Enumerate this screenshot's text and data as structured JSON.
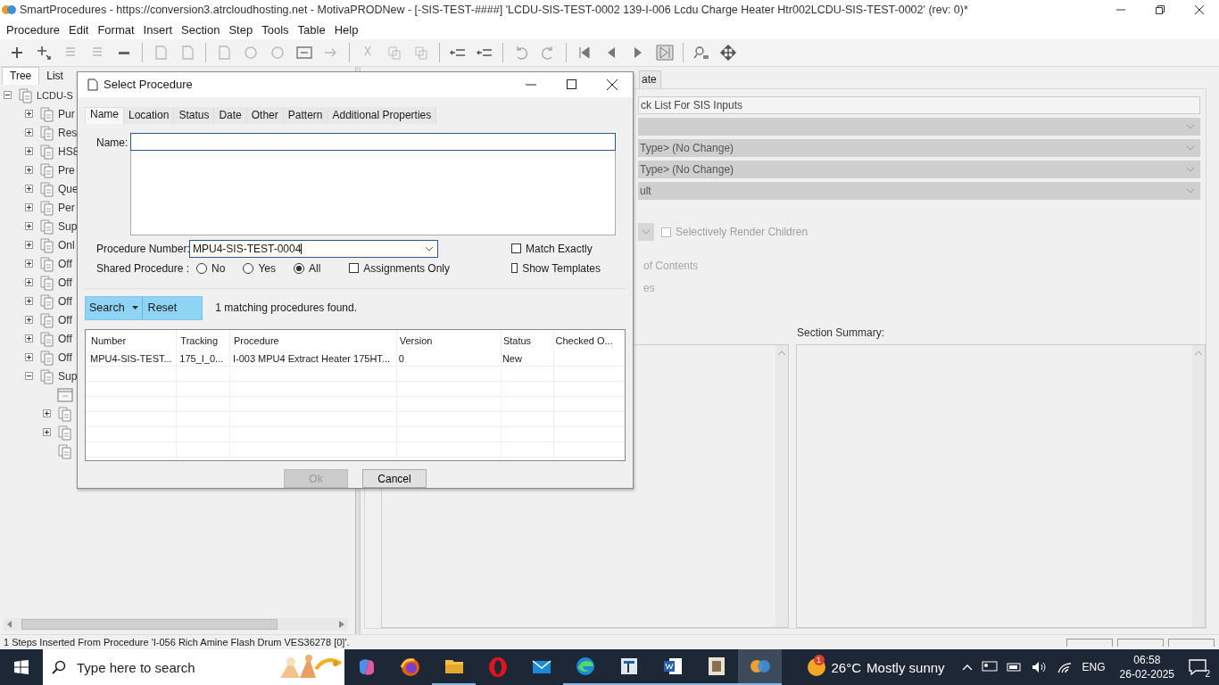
{
  "window": {
    "title": "SmartProcedures - https://conversion3.atrcloudhosting.net - MotivaPRODNew - [-SIS-TEST-####] 'LCDU-SIS-TEST-0002 139-I-006 Lcdu Charge Heater Htr002LCDU-SIS-TEST-0002' (rev: 0)*"
  },
  "menu": [
    "Procedure",
    "Edit",
    "Format",
    "Insert",
    "Section",
    "Step",
    "Tools",
    "Table",
    "Help"
  ],
  "left_panel": {
    "tabs": [
      {
        "label": "Tree",
        "selected": true
      },
      {
        "label": "List",
        "selected": false
      }
    ],
    "tree": {
      "label": "LCDU-S",
      "expanded": true,
      "children": [
        {
          "label": "Pur",
          "expanded": false
        },
        {
          "label": "Res",
          "expanded": false
        },
        {
          "label": "HS8",
          "expanded": false
        },
        {
          "label": "Pre",
          "expanded": false
        },
        {
          "label": "Que",
          "expanded": false
        },
        {
          "label": "Per",
          "expanded": false
        },
        {
          "label": "Sup",
          "expanded": false
        },
        {
          "label": "Onl",
          "expanded": false
        },
        {
          "label": "Off",
          "expanded": false
        },
        {
          "label": "Off",
          "expanded": false
        },
        {
          "label": "Off",
          "expanded": false
        },
        {
          "label": "Off",
          "expanded": false
        },
        {
          "label": "Off",
          "expanded": false
        },
        {
          "label": "Off",
          "expanded": false
        },
        {
          "label": "Sup",
          "expanded": true,
          "children": [
            {
              "kind": "step"
            },
            {
              "kind": "procedure",
              "expanded": false
            },
            {
              "kind": "procedure",
              "expanded": false
            },
            {
              "kind": "procedure"
            }
          ]
        }
      ]
    }
  },
  "right_panel": {
    "tabs": [
      {
        "label": "ate",
        "selected": true
      }
    ],
    "title_field": {
      "value": "ck List For SIS Inputs"
    },
    "dropdowns": [
      {
        "disabled": true
      },
      {
        "value": "Type> (No Change)",
        "disabled": true
      },
      {
        "value": "Type> (No Change)",
        "disabled": true
      },
      {
        "value": "ult",
        "disabled": true
      }
    ],
    "render_children": {
      "label": "Selectively Render Children",
      "checked": false,
      "disabled": true
    },
    "option_texts": [
      "of Contents",
      "es"
    ],
    "section_summary_label": "Section Summary:"
  },
  "dialog": {
    "title": "Select Procedure",
    "tabs": [
      {
        "label": "Name",
        "selected": true
      },
      {
        "label": "Location",
        "selected": false
      },
      {
        "label": "Status",
        "selected": false
      },
      {
        "label": "Date",
        "selected": false
      },
      {
        "label": "Other",
        "selected": false
      },
      {
        "label": "Pattern",
        "selected": false
      },
      {
        "label": "Additional Properties",
        "selected": false
      }
    ],
    "name_label": "Name:",
    "procedure_number": {
      "label": "Procedure Number:",
      "value": "MPU4-SIS-TEST-0004"
    },
    "shared": {
      "label": "Shared Procedure :",
      "options": [
        {
          "label": "No",
          "selected": false
        },
        {
          "label": "Yes",
          "selected": false
        },
        {
          "label": "All",
          "selected": true
        }
      ]
    },
    "match_exactly": {
      "label": "Match Exactly",
      "checked": false
    },
    "assignments_only": {
      "label": "Assignments Only",
      "checked": false
    },
    "show_templates": {
      "label": "Show Templates",
      "checked": false
    },
    "search_button": "Search",
    "reset_button": "Reset",
    "result_text": "1 matching procedures found.",
    "table": {
      "columns": [
        "Number",
        "Tracking",
        "Procedure",
        "Version",
        "Status",
        "Checked O..."
      ],
      "rows": [
        [
          "MPU4-SIS-TEST...",
          "175_I_0...",
          "I-003 MPU4 Extract Heater 175HT...",
          "0",
          "New",
          ""
        ]
      ]
    },
    "buttons": [
      {
        "label": "Ok",
        "disabled": true
      },
      {
        "label": "Cancel",
        "disabled": false
      }
    ]
  },
  "status_bar": {
    "text": "1 Steps Inserted From Procedure 'I-056 Rich Amine Flash Drum VES36278 [0]'."
  },
  "taskbar": {
    "search_placeholder": "Type here to search",
    "apps": [
      {
        "kind": "copilot",
        "running": false,
        "active": false
      },
      {
        "kind": "firefox",
        "running": false,
        "active": false
      },
      {
        "kind": "folder",
        "running": true,
        "active": false
      },
      {
        "kind": "opera",
        "running": false,
        "active": false
      },
      {
        "kind": "mail",
        "running": false,
        "active": false
      },
      {
        "kind": "edge",
        "running": true,
        "active": false
      },
      {
        "kind": "tool",
        "running": true,
        "active": false
      },
      {
        "kind": "word",
        "running": true,
        "active": false
      },
      {
        "kind": "viewer",
        "running": true,
        "active": false
      },
      {
        "kind": "smartprocedures",
        "running": true,
        "active": true
      }
    ],
    "weather": {
      "badge": "1",
      "temperature": "26°C",
      "condition": "Mostly sunny"
    },
    "language": "ENG",
    "time": "06:58",
    "date": "26-02-2025",
    "notifications": "2"
  }
}
